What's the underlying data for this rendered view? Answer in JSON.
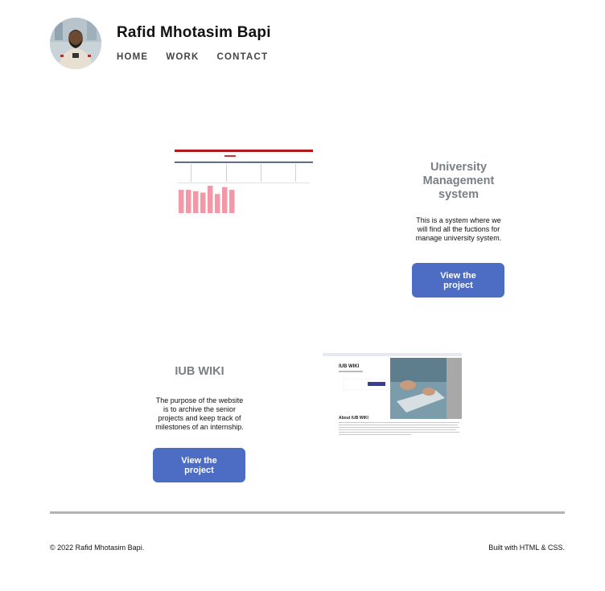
{
  "header": {
    "title": "Rafid Mhotasim Bapi",
    "nav": [
      {
        "label": "HOME"
      },
      {
        "label": "WORK"
      },
      {
        "label": "CONTACT"
      }
    ]
  },
  "projects": [
    {
      "title": "University Management system",
      "description": "This is a system where we will find all the fuctions for manage university system.",
      "button_label": "View the project",
      "thumbnail": {
        "header_bar_color": "#b01a1a",
        "nav_line_color": "#1f3a7a",
        "bar_color": "#f497a7",
        "bar_values": [
          0.85,
          0.85,
          0.8,
          0.75,
          1.0,
          0.7,
          0.95,
          0.85
        ]
      }
    },
    {
      "title": "IUB WIKI",
      "description": "The purpose of the website is to archive the senior projects and keep track of milestones of an internship.",
      "button_label": "View the project",
      "thumbnail": {
        "heading": "IUB WIKI",
        "subheading": "About IUB WIKI",
        "button_color": "#3a3f96"
      }
    }
  ],
  "footer": {
    "copyright": "© 2022 Rafid Mhotasim Bapi.",
    "built_with": "Built with HTML & CSS."
  },
  "colors": {
    "accent": "#4d6cc4",
    "title_gray": "#7a7f86",
    "divider": "#b3b3b3"
  }
}
